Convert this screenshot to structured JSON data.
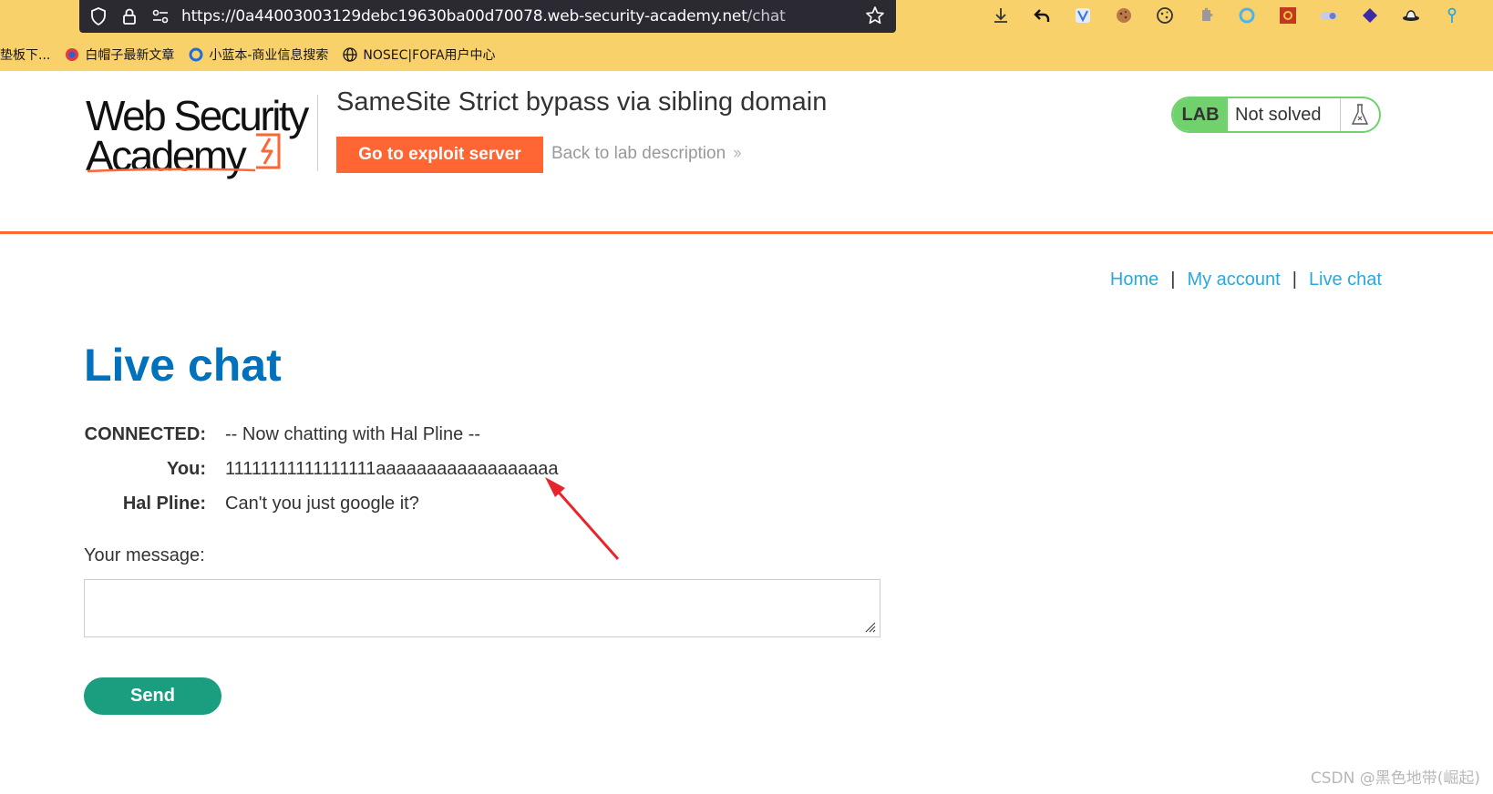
{
  "browser": {
    "url_main": "https://0a44003003129debc19630ba00d70078.web-security-academy.net",
    "url_path": "/chat",
    "bookmarks": [
      {
        "label": "垫板下..."
      },
      {
        "label": "白帽子最新文章"
      },
      {
        "label": "小蓝本-商业信息搜索"
      },
      {
        "label": "NOSEC|FOFA用户中心"
      }
    ]
  },
  "header": {
    "logo_line1": "Web Security",
    "logo_line2": "Academy",
    "lab_title": "SameSite Strict bypass via sibling domain",
    "exploit_button": "Go to exploit server",
    "back_link": "Back to lab description",
    "lab_badge": "LAB",
    "lab_status": "Not solved"
  },
  "nav": {
    "home": "Home",
    "account": "My account",
    "live_chat": "Live chat",
    "separator": "|"
  },
  "page": {
    "title": "Live chat"
  },
  "chat": {
    "messages": [
      {
        "who": "CONNECTED:",
        "text": "-- Now chatting with Hal Pline --"
      },
      {
        "who": "You:",
        "text": "11111111111111111aaaaaaaaaaaaaaaaaa"
      },
      {
        "who": "Hal Pline:",
        "text": "Can't you just google it?"
      }
    ]
  },
  "form": {
    "label": "Your message:",
    "value": "",
    "send_button": "Send"
  },
  "colors": {
    "accent_orange": "#ff6633",
    "link_blue": "#29a8e0",
    "title_blue": "#0071bc",
    "lab_green": "#70d16d",
    "send_green": "#1a9e7f",
    "annotation_red": "#e8252b"
  },
  "watermark": "CSDN @黑色地带(崛起)"
}
